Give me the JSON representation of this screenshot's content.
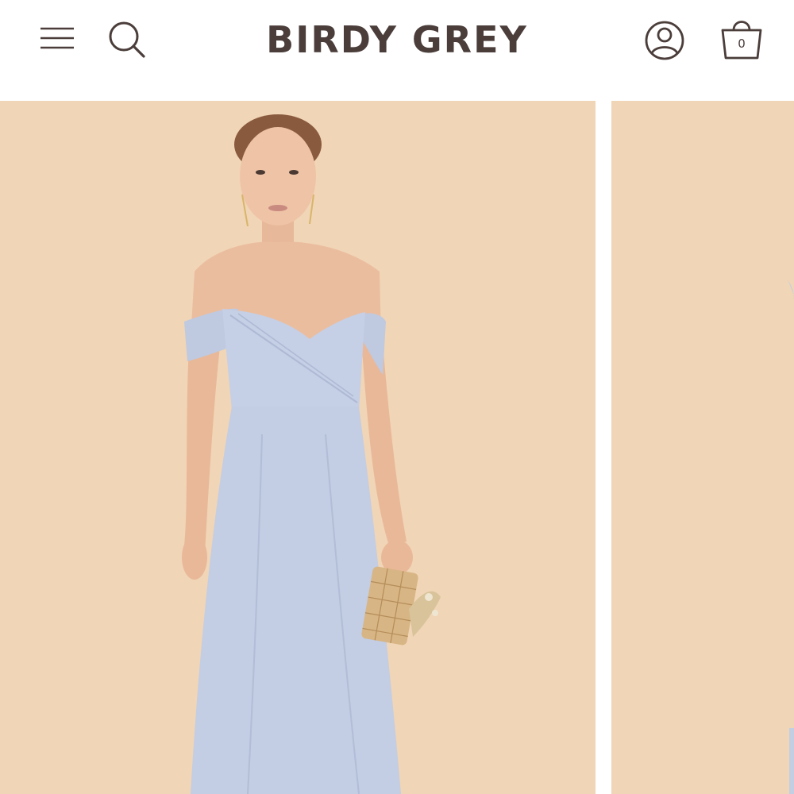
{
  "header": {
    "brand": "BIRDY GREY",
    "cart_count": "0",
    "icons": {
      "menu": "hamburger-menu-icon",
      "search": "search-icon",
      "account": "user-account-icon",
      "cart": "shopping-bag-icon"
    }
  },
  "colors": {
    "brand_text": "#4a3d3a",
    "backdrop": "#f0d5b6",
    "dress": "#c3cde3"
  },
  "gallery": {
    "slides": [
      {
        "name": "model-photo-front"
      },
      {
        "name": "model-photo-next"
      }
    ]
  }
}
